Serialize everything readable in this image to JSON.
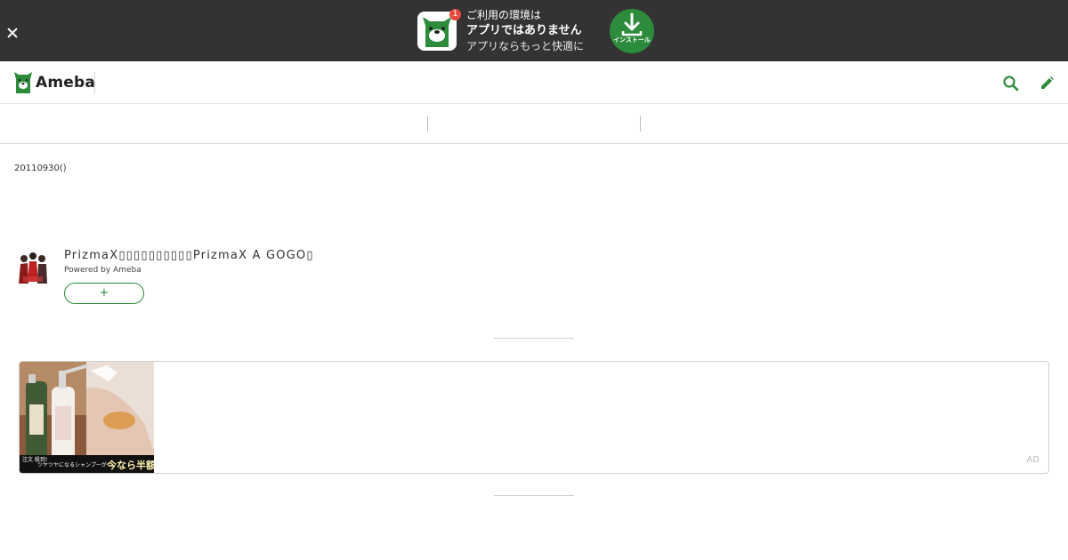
{
  "banner": {
    "line1": "ご利用の環境は",
    "line2": "アプリではありません",
    "line3": "アプリならもっと快適に",
    "badge_count": "1",
    "install_label": "インストール",
    "close_icon": "close-icon",
    "app_icon": "ameba-app-icon",
    "download_icon": "download-icon"
  },
  "header": {
    "logo_text": "Ameba",
    "search_icon": "search-icon",
    "edit_icon": "pencil-icon"
  },
  "tabs": [
    {
      "label": ""
    },
    {
      "label": ""
    },
    {
      "label": ""
    }
  ],
  "entry": {
    "date": "20110930()"
  },
  "blog": {
    "title": "PrizmaX▯▯▯▯▯▯▯▯▯▯PrizmaX A GOGO▯",
    "powered_by": "Powered by Ameba",
    "follow_label": "+"
  },
  "ad": {
    "label": "AD",
    "caption_small": "注文 殺到!",
    "caption_mid": "ツヤツヤになるシャンプーが",
    "caption_big": "今なら半額!"
  },
  "colors": {
    "banner_bg": "#333333",
    "brand_green": "#2d8c3c",
    "badge_red": "#e54b3f"
  }
}
